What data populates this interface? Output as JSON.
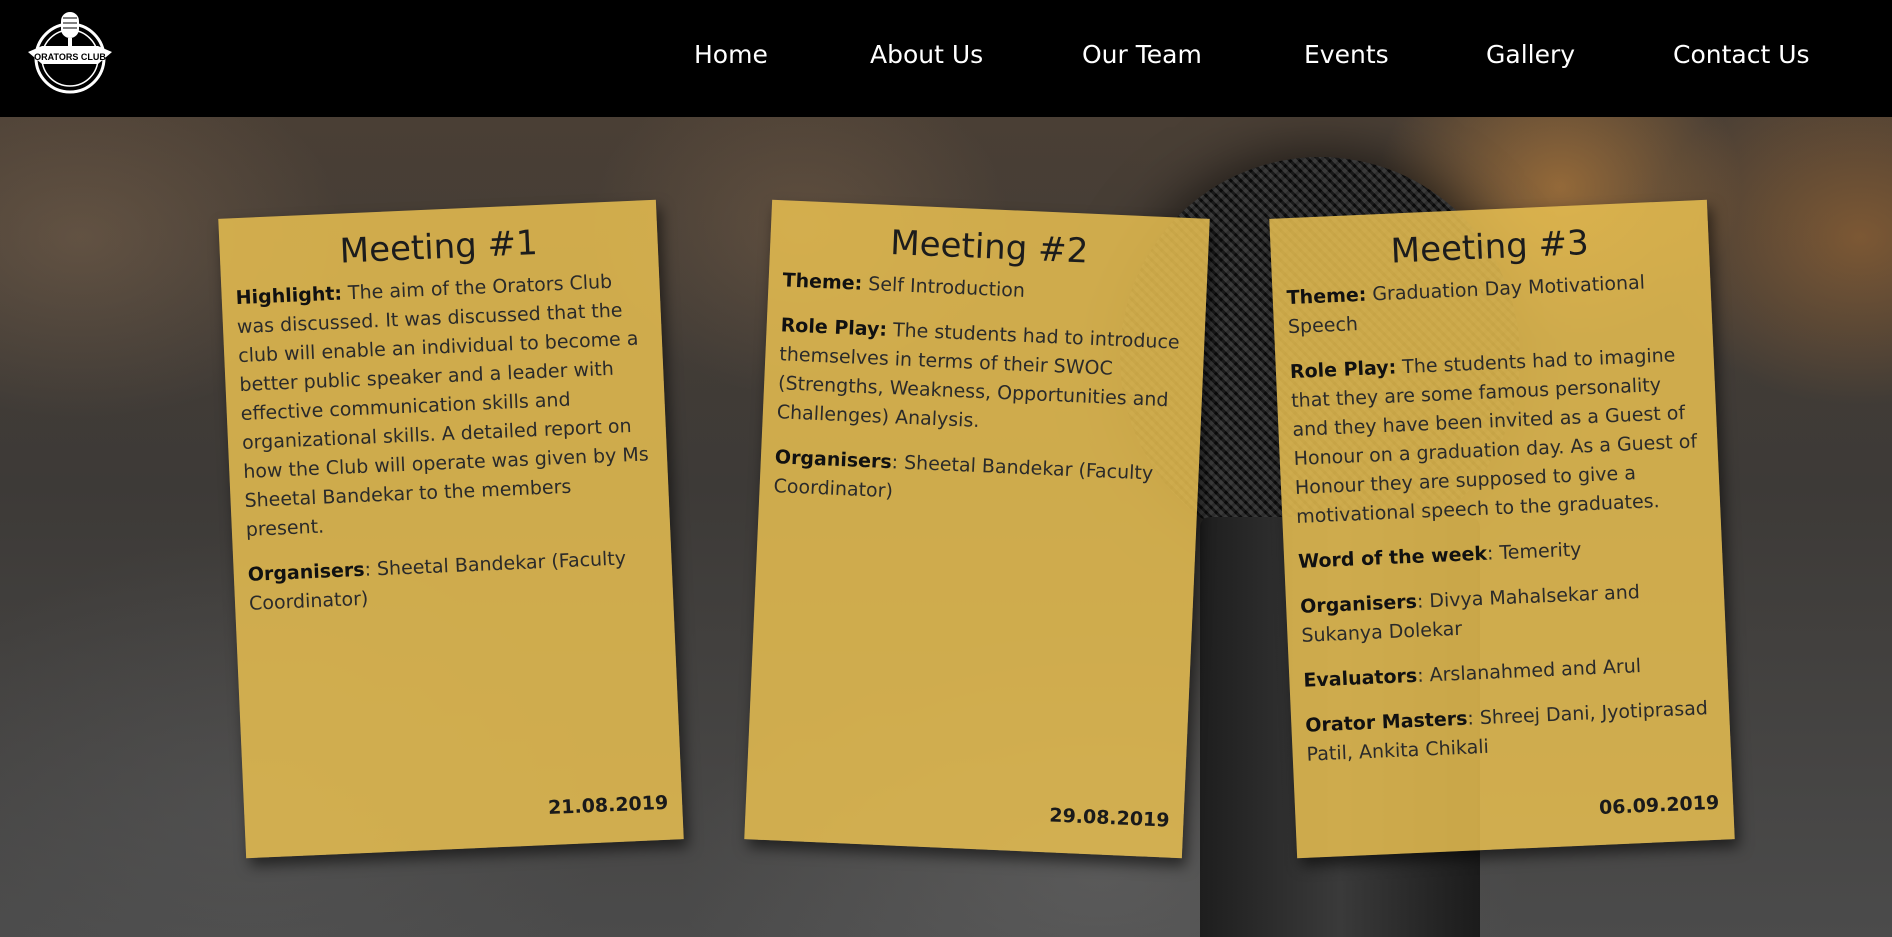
{
  "nav": {
    "logo_text": "ORATORS CLUB",
    "items": [
      "Home",
      "About Us",
      "Our Team",
      "Events",
      "Gallery",
      "Contact Us"
    ]
  },
  "meetings": [
    {
      "title": "Meeting #1",
      "highlight_label": "Highlight:",
      "highlight_text": " The aim of the Orators Club was discussed. It was discussed that the club will enable an individual to become a better public speaker and a leader with effective communication skills and organizational skills. A detailed report on how the Club will operate was given by Ms Sheetal Bandekar to the members present.",
      "organisers_label": "Organisers",
      "organisers_text": ": Sheetal Bandekar (Faculty Coordinator)",
      "date": "21.08.2019"
    },
    {
      "title": "Meeting #2",
      "theme_label": "Theme:",
      "theme_text": " Self Introduction",
      "roleplay_label": "Role Play:",
      "roleplay_text": " The students had to introduce themselves in terms of their SWOC (Strengths, Weakness, Opportunities and Challenges) Analysis.",
      "organisers_label": "Organisers",
      "organisers_text": ": Sheetal Bandekar (Faculty Coordinator)",
      "date": "29.08.2019"
    },
    {
      "title": "Meeting #3",
      "theme_label": "Theme:",
      "theme_text": " Graduation Day Motivational Speech",
      "roleplay_label": "Role Play:",
      "roleplay_text": " The students had to imagine that they are some famous personality and they have been invited as a Guest of Honour on a graduation day. As a Guest of Honour they are supposed to give a motivational speech to the graduates.",
      "word_label": "Word of the week",
      "word_text": ": Temerity",
      "organisers_label": "Organisers",
      "organisers_text": ": Divya Mahalsekar and Sukanya Dolekar",
      "evaluators_label": "Evaluators",
      "evaluators_text": ": Arslanahmed and Arul",
      "masters_label": "Orator Masters",
      "masters_text": ": Shreej Dani, Jyotiprasad Patil, Ankita Chikali",
      "date": "06.09.2019"
    }
  ]
}
